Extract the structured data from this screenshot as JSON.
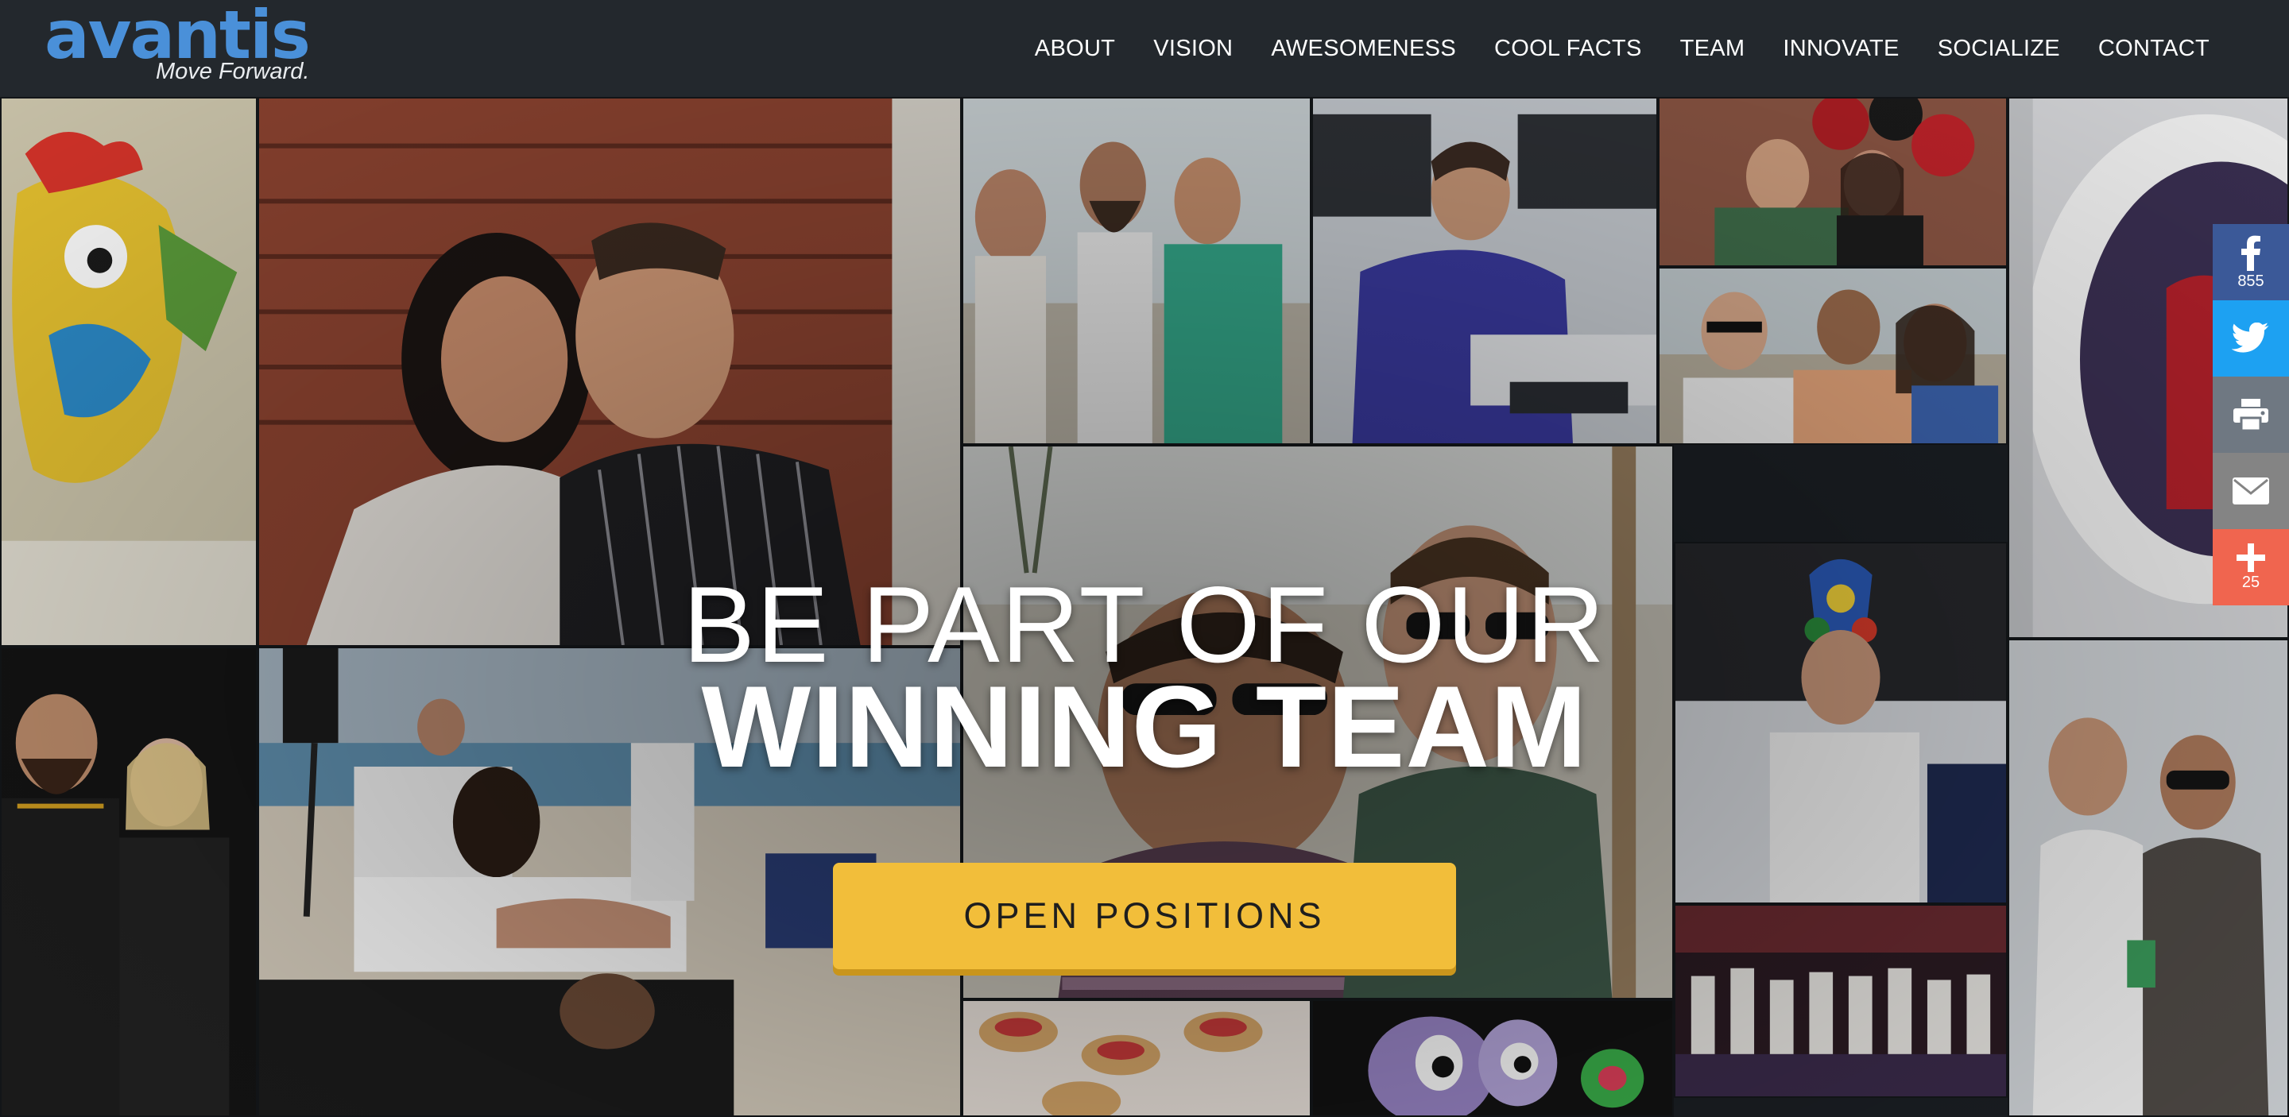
{
  "brand": {
    "name": "avantis",
    "tagline": "Move Forward."
  },
  "nav": {
    "items": [
      {
        "label": "ABOUT"
      },
      {
        "label": "VISION"
      },
      {
        "label": "AWESOMENESS"
      },
      {
        "label": "COOL FACTS"
      },
      {
        "label": "TEAM"
      },
      {
        "label": "INNOVATE"
      },
      {
        "label": "SOCIALIZE"
      },
      {
        "label": "CONTACT"
      }
    ]
  },
  "hero": {
    "line1": "BE PART OF OUR",
    "line2": "WINNING TEAM",
    "cta_label": "OPEN POSITIONS"
  },
  "share": {
    "facebook_count": "855",
    "addthis_count": "25"
  },
  "colors": {
    "header_bg": "#23282d",
    "logo_blue": "#4a90d9",
    "cta_yellow": "#f2be3a",
    "facebook": "#3b5998",
    "twitter": "#1da1f2",
    "print": "#6f7882",
    "email": "#848484",
    "addthis": "#f0654f"
  }
}
